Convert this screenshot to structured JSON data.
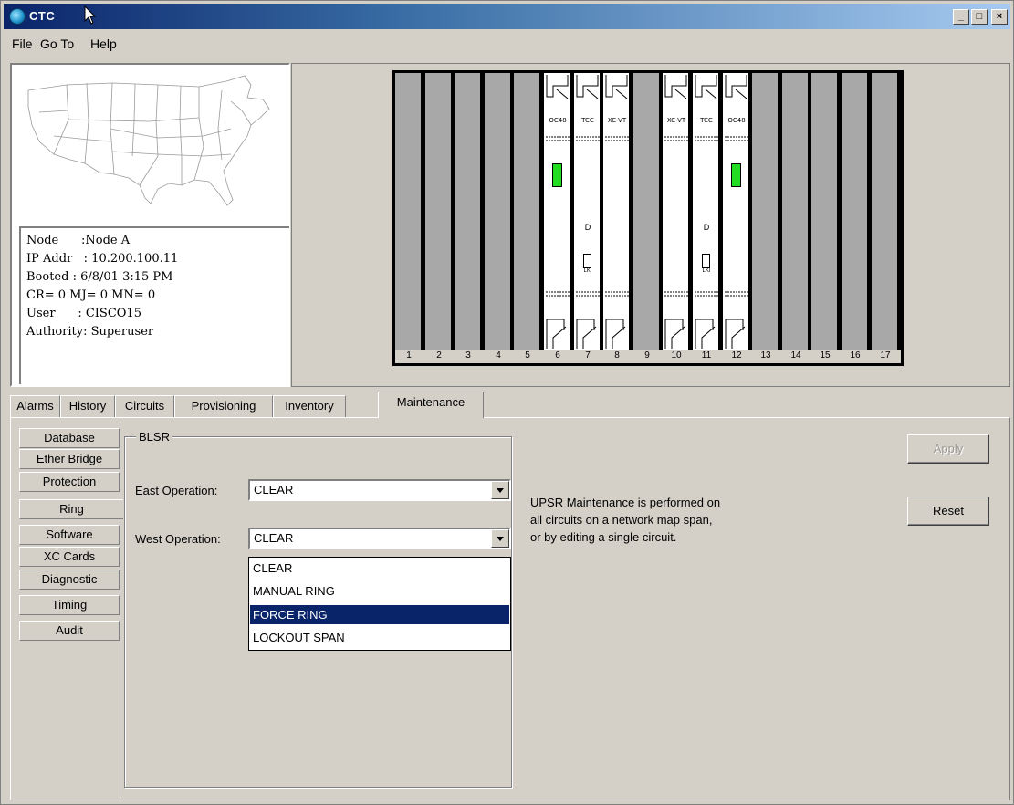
{
  "window": {
    "title": "CTC",
    "min_label": "_",
    "max_label": "□",
    "close_label": "×"
  },
  "menu": {
    "items": [
      {
        "label": "File"
      },
      {
        "label": "Go To"
      },
      {
        "label": "Help"
      }
    ]
  },
  "node_info": {
    "lines": [
      "Node      :Node A",
      "IP Addr   : 10.200.100.11",
      "Booted : 6/8/01 3:15 PM",
      "CR= 0 MJ= 0 MN= 0",
      "User      : CISCO15",
      "Authority: Superuser"
    ]
  },
  "shelf": {
    "slot_numbers": [
      "1",
      "2",
      "3",
      "4",
      "5",
      "6",
      "7",
      "8",
      "9",
      "10",
      "11",
      "12",
      "13",
      "14",
      "15",
      "16",
      "17"
    ],
    "cards": [
      {
        "slot": "6",
        "label": "OC48",
        "led": true
      },
      {
        "slot": "7",
        "label": "TCC",
        "status": "D",
        "led_text": "LKI"
      },
      {
        "slot": "8",
        "label": "XC-VT"
      },
      {
        "slot": "10",
        "label": "XC-VT"
      },
      {
        "slot": "11",
        "label": "TCC",
        "status": "D",
        "led_text": "LKI"
      },
      {
        "slot": "12",
        "label": "OC48",
        "led": true
      }
    ],
    "led_color": "#22dd22"
  },
  "tabs": [
    {
      "label": "Alarms"
    },
    {
      "label": "History"
    },
    {
      "label": "Circuits"
    },
    {
      "label": "Provisioning"
    },
    {
      "label": "Inventory"
    },
    {
      "label": "Maintenance",
      "active": true
    }
  ],
  "subtabs": [
    {
      "label": "Database"
    },
    {
      "label": "Ether Bridge"
    },
    {
      "label": "Protection"
    },
    {
      "label": "Ring",
      "active": true
    },
    {
      "label": "Software"
    },
    {
      "label": "XC Cards"
    },
    {
      "label": "Diagnostic"
    },
    {
      "label": "Timing"
    },
    {
      "label": "Audit"
    }
  ],
  "blsr": {
    "group_title": "BLSR",
    "east_label": "East Operation:",
    "east_value": "CLEAR",
    "west_label": "West Operation:",
    "west_value": "CLEAR",
    "options": [
      "CLEAR",
      "MANUAL RING",
      "FORCE RING",
      "LOCKOUT SPAN"
    ],
    "highlighted_option": "FORCE RING"
  },
  "info": {
    "lines": [
      "UPSR Maintenance is performed on",
      "all circuits on a network map span,",
      "or by editing a single circuit."
    ]
  },
  "buttons": {
    "apply": "Apply",
    "reset": "Reset"
  },
  "colors": {
    "title_start": "#0a246a",
    "selection": "#0a246a"
  }
}
